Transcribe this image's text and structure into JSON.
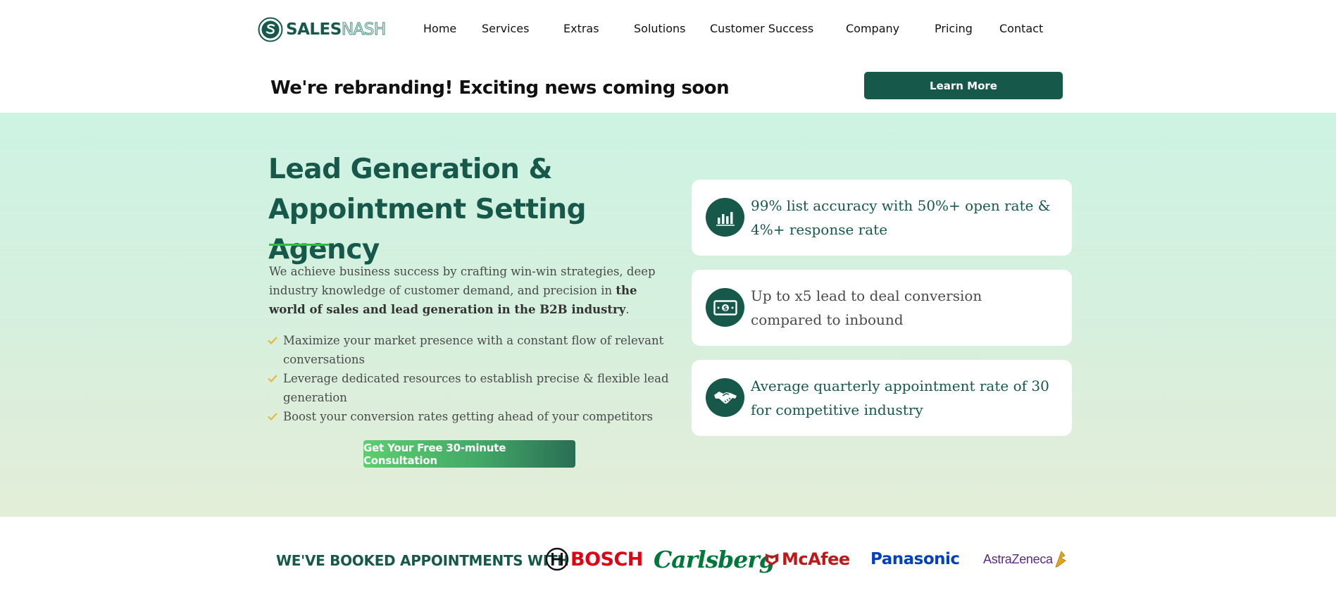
{
  "header": {
    "logo": {
      "part1": "SALES",
      "part2": "NASH"
    },
    "nav": [
      "Home",
      "Services",
      "Extras",
      "Solutions",
      "Customer Success",
      "Company",
      "Pricing",
      "Contact"
    ]
  },
  "announcement": {
    "text": "We're rebranding! Exciting news coming soon",
    "button_label": "Learn More"
  },
  "hero": {
    "title_line1": "Lead Generation &",
    "title_line2": "Appointment Setting Agency",
    "description_plain": "We achieve business success by crafting win-win strategies, deep industry knowledge of customer demand, and precision in ",
    "description_bold": "the world of sales and lead generation in the B2B industry",
    "description_end": ".",
    "bullets": [
      "Maximize your market presence with a constant flow of relevant conversations",
      "Leverage dedicated resources to establish precise & flexible lead generation",
      "Boost your conversion rates getting ahead of your competitors"
    ],
    "cta_label": "Get Your Free 30-minute Consultation"
  },
  "stats": [
    {
      "icon": "bar-chart-icon",
      "text": "99% list accuracy with 50%+ open rate & 4%+ response rate",
      "color": "#16594a"
    },
    {
      "icon": "money-bill-icon",
      "text": "Up to x5 lead to deal conversion compared to inbound",
      "color": "#4a4a4a"
    },
    {
      "icon": "handshake-icon",
      "text": "Average quarterly appointment rate of 30 for competitive industry",
      "color": "#16594a"
    }
  ],
  "clients": {
    "heading": "WE'VE BOOKED APPOINTMENTS WITH",
    "logos": [
      {
        "name": "BOSCH",
        "color": "#e20015"
      },
      {
        "name": "Carlsberg",
        "color": "#00783c"
      },
      {
        "name": "McAfee",
        "color": "#c01818"
      },
      {
        "name": "Panasonic",
        "color": "#0041c0"
      },
      {
        "name": "AstraZeneca",
        "color": "#5a2a82"
      }
    ]
  },
  "colors": {
    "brand_green": "#16594a",
    "accent_green": "#2fbf3f",
    "check_yellow": "#e8b83a"
  }
}
